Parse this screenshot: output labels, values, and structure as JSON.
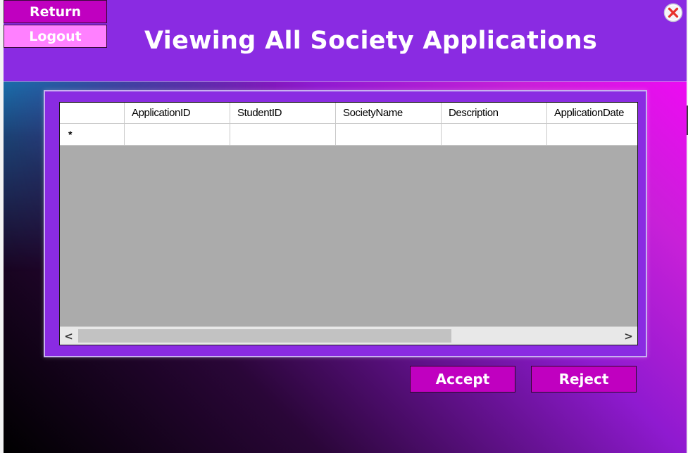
{
  "window": {
    "title": "Viewing All Society Applications",
    "accent_color": "#8a2be2",
    "button_color": "#c000c0"
  },
  "nav": {
    "return_label": "Return",
    "logout_label": "Logout"
  },
  "grid": {
    "columns": [
      "ApplicationID",
      "StudentID",
      "SocietyName",
      "Description",
      "ApplicationDate"
    ],
    "new_row_marker": "*",
    "rows": []
  },
  "scrollbar": {
    "left_arrow": "<",
    "right_arrow": ">"
  },
  "actions": {
    "accept_label": "Accept",
    "reject_label": "Reject"
  },
  "icons": {
    "close": "close-icon"
  }
}
